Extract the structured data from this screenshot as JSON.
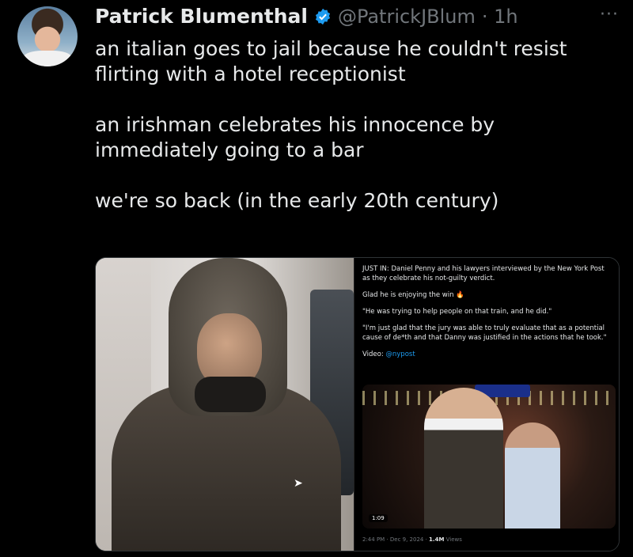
{
  "author": {
    "name": "Patrick Blumenthal",
    "handle": "@PatrickJBlum",
    "time": "· 1h",
    "verified_color": "#1d9bf0",
    "avatar_icon": "avatar-portrait"
  },
  "more_label": "···",
  "tweet": {
    "paragraphs": [
      "an italian goes to jail because he couldn't resist flirting with a hotel receptionist",
      "an irishman celebrates his innocence by immediately going to a bar",
      "we're so back (in the early 20th century)"
    ]
  },
  "embed": {
    "line1": "JUST IN: Daniel Penny and his lawyers interviewed by the New York Post as they celebrate his not-guilty verdict.",
    "line2": "Glad he is enjoying the win 🔥",
    "line3": "\"He was trying to help people on that train, and he did.\"",
    "line4": "\"I'm just glad that the jury was able to truly evaluate that as a potential cause of de*th and that Danny was justified in the actions that he took.\"",
    "video_label": "Video: ",
    "video_link": "@nypost",
    "duration": "1:09",
    "timestamp": "2:44 PM · Dec 9, 2024 · ",
    "views": "1.4M",
    "views_label": " Views"
  },
  "colors": {
    "background": "#000000",
    "text": "#e7e9ea",
    "muted": "#71767b",
    "accent": "#1d9bf0"
  }
}
